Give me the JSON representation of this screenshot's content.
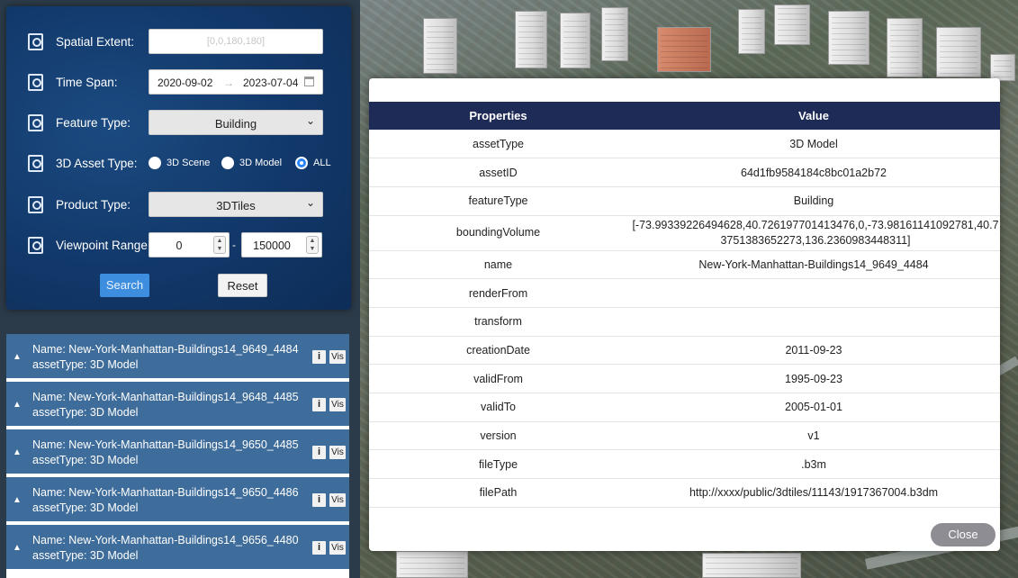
{
  "search": {
    "spatial_extent": {
      "label": "Spatial Extent:",
      "placeholder": "[0,0,180,180]",
      "icon": "map-pin-icon"
    },
    "time_span": {
      "label": "Time Span:",
      "start": "2020-09-02",
      "arrow": "→",
      "end": "2023-07-04",
      "icon": "calendar-icon"
    },
    "feature_type": {
      "label": "Feature Type:",
      "value": "Building",
      "icon": "feature-icon"
    },
    "asset_type": {
      "label": "3D Asset Type:",
      "options": [
        "3D Scene",
        "3D Model",
        "ALL"
      ],
      "selected": "ALL",
      "icon": "document-icon"
    },
    "product_type": {
      "label": "Product Type:",
      "value": "3DTiles",
      "icon": "product-icon"
    },
    "viewpoint_range": {
      "label": "Viewpoint Range:",
      "min": "0",
      "separator": "-",
      "max": "150000",
      "icon": "range-icon"
    },
    "search_label": "Search",
    "reset_label": "Reset"
  },
  "results": [
    {
      "name": "Name: New-York-Manhattan-Buildings14_9649_4484",
      "type": "assetType: 3D Model",
      "info": "i",
      "vis": "Vis"
    },
    {
      "name": "Name: New-York-Manhattan-Buildings14_9648_4485",
      "type": "assetType: 3D Model",
      "info": "i",
      "vis": "Vis"
    },
    {
      "name": "Name: New-York-Manhattan-Buildings14_9650_4485",
      "type": "assetType: 3D Model",
      "info": "i",
      "vis": "Vis"
    },
    {
      "name": "Name: New-York-Manhattan-Buildings14_9650_4486",
      "type": "assetType: 3D Model",
      "info": "i",
      "vis": "Vis"
    },
    {
      "name": "Name: New-York-Manhattan-Buildings14_9656_4480",
      "type": "assetType: 3D Model",
      "info": "i",
      "vis": "Vis"
    }
  ],
  "dialog": {
    "headers": [
      "Properties",
      "Value"
    ],
    "rows": [
      {
        "key": "assetType",
        "value": "3D Model"
      },
      {
        "key": "assetID",
        "value": "64d1fb9584184c8bc01a2b72"
      },
      {
        "key": "featureType",
        "value": "Building"
      },
      {
        "key": "boundingVolume",
        "value": "[-73.99339226494628,40.726197701413476,0,-73.98161141092781,40.73751383652273,136.2360983448311]"
      },
      {
        "key": "name",
        "value": "New-York-Manhattan-Buildings14_9649_4484"
      },
      {
        "key": "renderFrom",
        "value": ""
      },
      {
        "key": "transform",
        "value": ""
      },
      {
        "key": "creationDate",
        "value": "2011-09-23"
      },
      {
        "key": "validFrom",
        "value": "1995-09-23"
      },
      {
        "key": "validTo",
        "value": "2005-01-01"
      },
      {
        "key": "version",
        "value": "v1"
      },
      {
        "key": "fileType",
        "value": ".b3m"
      },
      {
        "key": "filePath",
        "value": "http://xxxx/public/3dtiles/11143/1917367004.b3dm"
      }
    ],
    "close_label": "Close"
  },
  "colors": {
    "panel": "#12386a",
    "result_row": "#3f6d9b",
    "table_header": "#1e2b57",
    "search_button": "#3d8ede",
    "close_button": "#8e8d93"
  }
}
